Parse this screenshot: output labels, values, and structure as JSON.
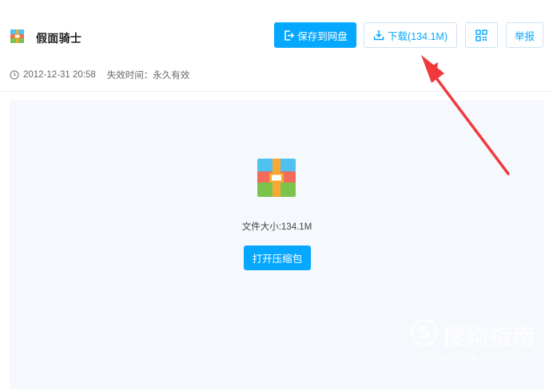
{
  "file": {
    "name": "假面骑士",
    "icon": "zip-archive-icon",
    "date": "2012-12-31 20:58",
    "expire": "失效时间：永久有效"
  },
  "toolbar": {
    "save_label": "保存到网盘",
    "download_label": "下载(134.1M)",
    "qr_icon": "qrcode-icon",
    "report_label": "举报"
  },
  "preview": {
    "icon": "zip-archive-icon",
    "size_text": "文件大小:134.1M",
    "open_label": "打开压缩包"
  },
  "annotation": {
    "type": "red-arrow",
    "points_to": "download-button",
    "color": "#f0393a"
  },
  "watermark": {
    "logo_letter": "S",
    "text": "搜狗指南",
    "url": "zhinan.sogou.com"
  },
  "colors": {
    "accent": "#06a7ff",
    "preview_bg": "#f5f8fd",
    "arrow": "#f0393a"
  }
}
